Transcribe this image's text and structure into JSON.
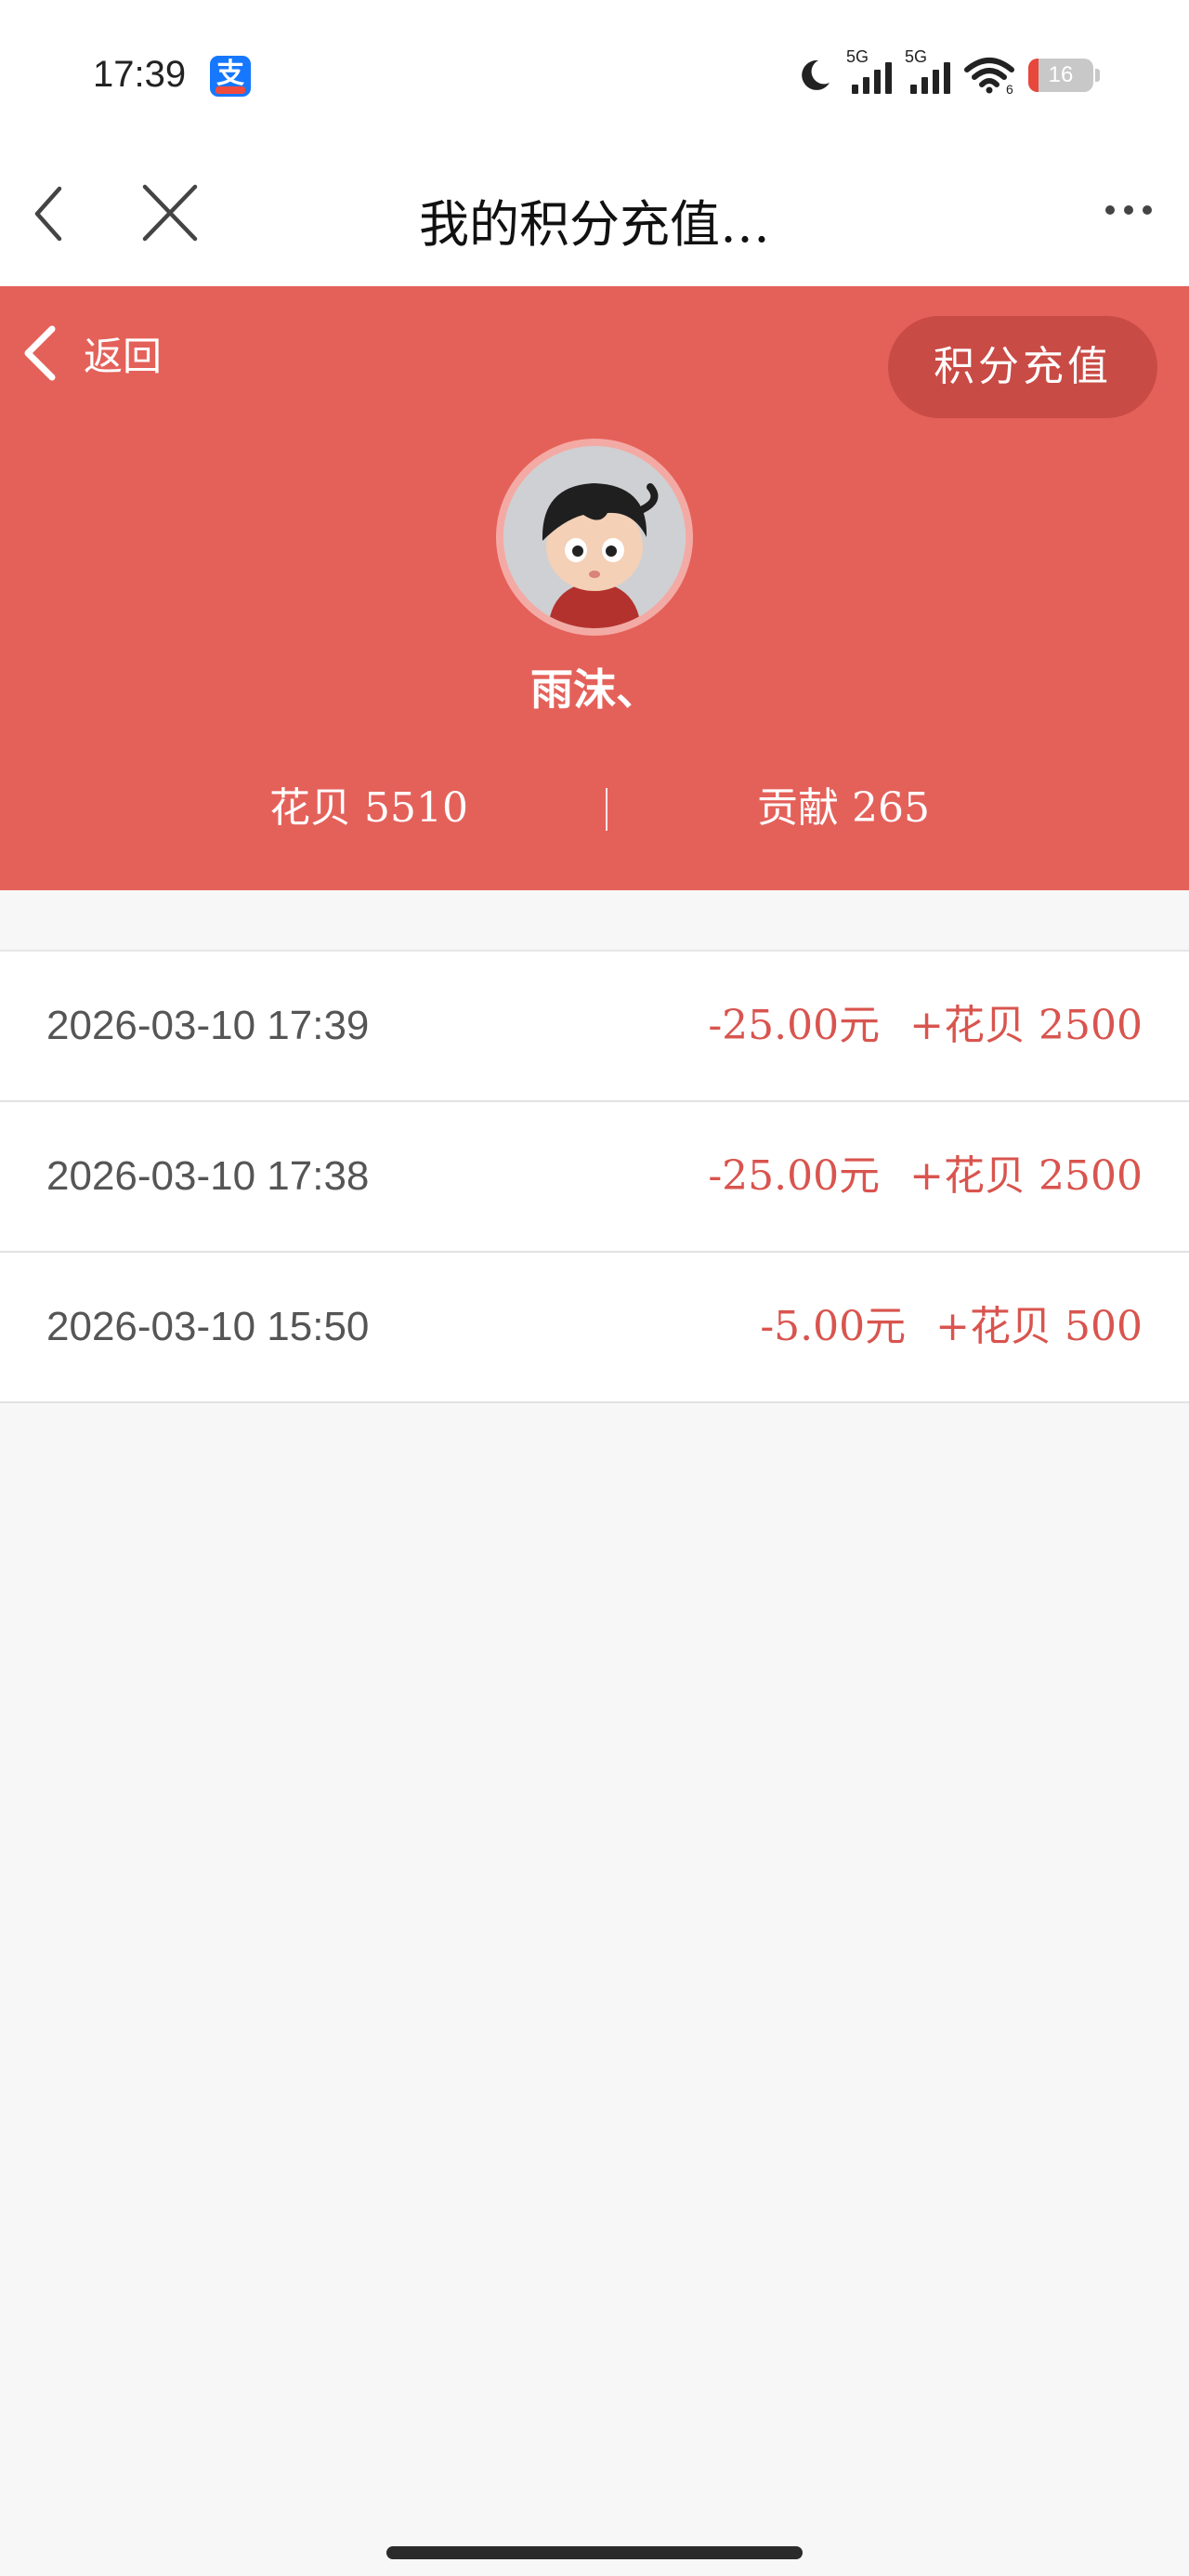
{
  "status_bar": {
    "time": "17:39",
    "app_badge": "支",
    "signal1_label": "5G",
    "signal2_label": "5G",
    "wifi_label": "6",
    "battery": "16",
    "battery_level": 0.16
  },
  "nav": {
    "title": "我的积分充值…"
  },
  "header": {
    "back_label": "返回",
    "recharge_label": "积分充值",
    "username": "雨沫、",
    "huabei": "花贝 5510",
    "gongxian": "贡献 265",
    "bg_color": "#e4615a"
  },
  "records": [
    {
      "date": "2026-03-10 17:39",
      "amount": "-25.00元",
      "points": "+花贝 2500"
    },
    {
      "date": "2026-03-10 17:38",
      "amount": "-25.00元",
      "points": "+花贝 2500"
    },
    {
      "date": "2026-03-10 15:50",
      "amount": "-5.00元",
      "points": "+花贝 500"
    }
  ]
}
